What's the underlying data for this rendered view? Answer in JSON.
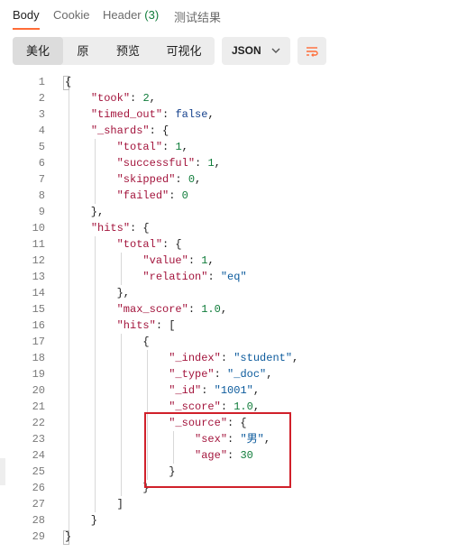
{
  "tabs": {
    "body": "Body",
    "cookie": "Cookie",
    "header": "Header",
    "header_count": "(3)",
    "results": "测试结果"
  },
  "toolbar": {
    "pretty": "美化",
    "raw": "原",
    "preview": "预览",
    "visualize": "可视化",
    "format": "JSON",
    "chevron_icon": "chevron-down",
    "wrap_icon": "wrap-lines"
  },
  "colors": {
    "accent": "#ff6c37",
    "key": "#a3143c",
    "string": "#0b5a9c",
    "number": "#0f7c3a",
    "keyword": "#14408c",
    "highlight_box": "#d0202a"
  },
  "code": {
    "lines": [
      "{",
      "    \"took\": 2,",
      "    \"timed_out\": false,",
      "    \"_shards\": {",
      "        \"total\": 1,",
      "        \"successful\": 1,",
      "        \"skipped\": 0,",
      "        \"failed\": 0",
      "    },",
      "    \"hits\": {",
      "        \"total\": {",
      "            \"value\": 1,",
      "            \"relation\": \"eq\"",
      "        },",
      "        \"max_score\": 1.0,",
      "        \"hits\": [",
      "            {",
      "                \"_index\": \"student\",",
      "                \"_type\": \"_doc\",",
      "                \"_id\": \"1001\",",
      "                \"_score\": 1.0,",
      "                \"_source\": {",
      "                    \"sex\": \"男\",",
      "                    \"age\": 30",
      "                }",
      "            }",
      "        ]",
      "    }",
      "}"
    ]
  }
}
